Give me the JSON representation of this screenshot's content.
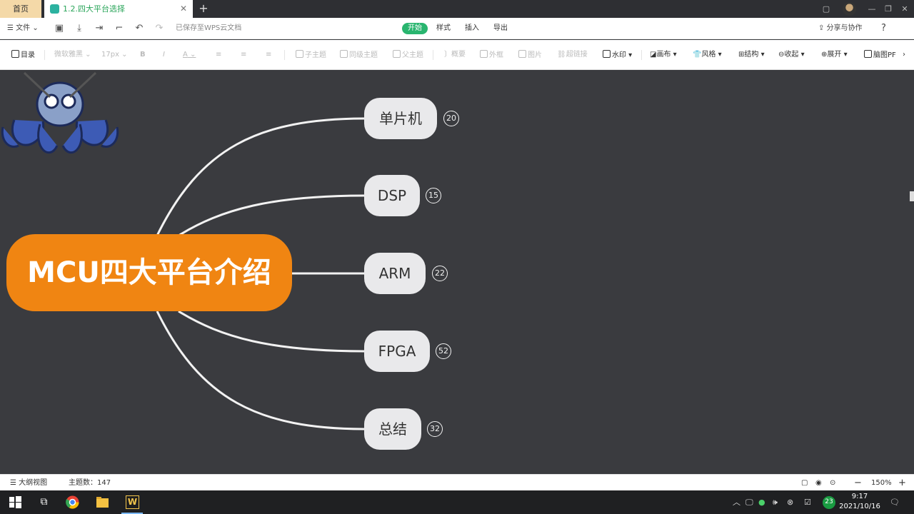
{
  "tabs": {
    "home_label": "首页",
    "doc_label": "1.2.四大平台选择"
  },
  "menubar": {
    "file_label": "文件",
    "save_status": "已保存至WPS云文档",
    "ribbon_tabs": [
      "开始",
      "样式",
      "插入",
      "导出"
    ],
    "share_label": "分享与协作",
    "help_label": "?"
  },
  "toolbar": {
    "outline_label": "目录",
    "font_family": "微软雅黑",
    "font_size": "17px",
    "bold": "B",
    "italic": "I",
    "font_color": "A",
    "subtopic": "子主题",
    "sibling": "同级主题",
    "parent": "父主题",
    "summary": "概要",
    "frame": "外框",
    "image": "图片",
    "hyperlink": "超链接",
    "watermark": "水印",
    "canvas": "画布",
    "style": "风格",
    "structure": "结构",
    "collapse": "收起",
    "expand": "展开",
    "export": "脑图PF"
  },
  "mindmap": {
    "root": "MCU四大平台介绍",
    "children": [
      {
        "label": "单片机",
        "count": "20"
      },
      {
        "label": "DSP",
        "count": "15"
      },
      {
        "label": "ARM",
        "count": "22"
      },
      {
        "label": "FPGA",
        "count": "52"
      },
      {
        "label": "总结",
        "count": "32"
      }
    ]
  },
  "statusbar": {
    "outline_view": "大纲视图",
    "topic_count": "主题数：147",
    "zoom": "150%",
    "zoom_out": "−",
    "zoom_in": "+"
  },
  "taskbar": {
    "time": "9:17",
    "date": "2021/10/16",
    "notify_badge": "23"
  },
  "colors": {
    "root_bg": "#f08512",
    "canvas_bg": "#3a3b3f",
    "node_bg": "#e9e9eb",
    "accent": "#29b56f"
  }
}
